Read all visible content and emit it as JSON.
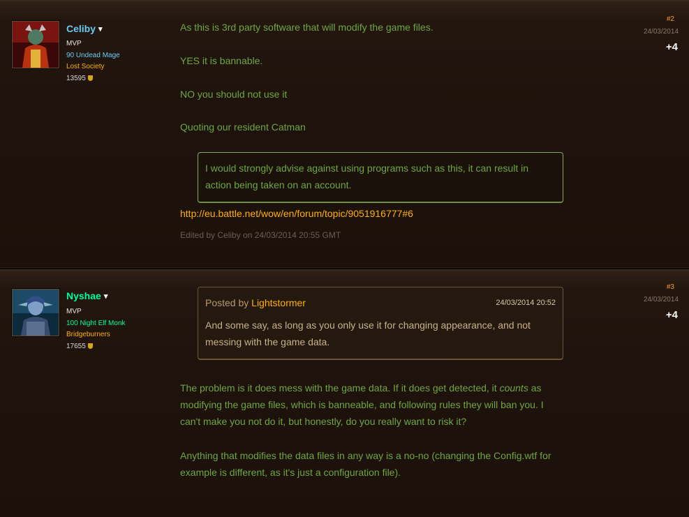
{
  "posts": [
    {
      "user": {
        "name": "Celiby",
        "rank": "MVP",
        "class_line": "90 Undead Mage",
        "guild": "Lost Society",
        "points": "13595"
      },
      "post_number": "#2",
      "date": "24/03/2014",
      "score": "+4",
      "paragraphs": [
        "As this is 3rd party software that will modify the game files.",
        "YES it is bannable.",
        "NO you should not use it",
        "Quoting our resident Catman"
      ],
      "blockquote": "I would strongly advise against using programs such as this, it can result in action being taken on an account.",
      "link": "http://eu.battle.net/wow/en/forum/topic/9051916777#6",
      "edited": "Edited by Celiby on 24/03/2014 20:55 GMT"
    },
    {
      "user": {
        "name": "Nyshae",
        "rank": "MVP",
        "class_line": "100 Night Elf Monk",
        "guild": "Bridgeburners",
        "points": "17655"
      },
      "post_number": "#3",
      "date": "24/03/2014",
      "score": "+4",
      "quote": {
        "posted_by_label": "Posted by",
        "author": "Lightstormer",
        "date": "24/03/2014 20:52",
        "text": "And some say, as long as you only use it for changing appearance, and not messing with the game data."
      },
      "paragraph1_a": "The problem is it does mess with the game data. If it does get detected, it ",
      "paragraph1_em": "counts",
      "paragraph1_b": " as modifying the game files, which is banneable, and following rules they will ban you. I can't make you not do it, but honestly, do you really want to risk it?",
      "paragraph2": "Anything that modifies the data files in any way is a no-no (changing the Config.wtf for example is different, as it's just a configuration file)."
    }
  ],
  "colors": {
    "mage": "#69ccf0",
    "monk": "#00ff96",
    "guild": "#ffb100",
    "post_text": "#6fa640",
    "post_number": "#f0a23a"
  },
  "icons": [
    "chevron-down-icon",
    "achievement-shield-icon"
  ]
}
